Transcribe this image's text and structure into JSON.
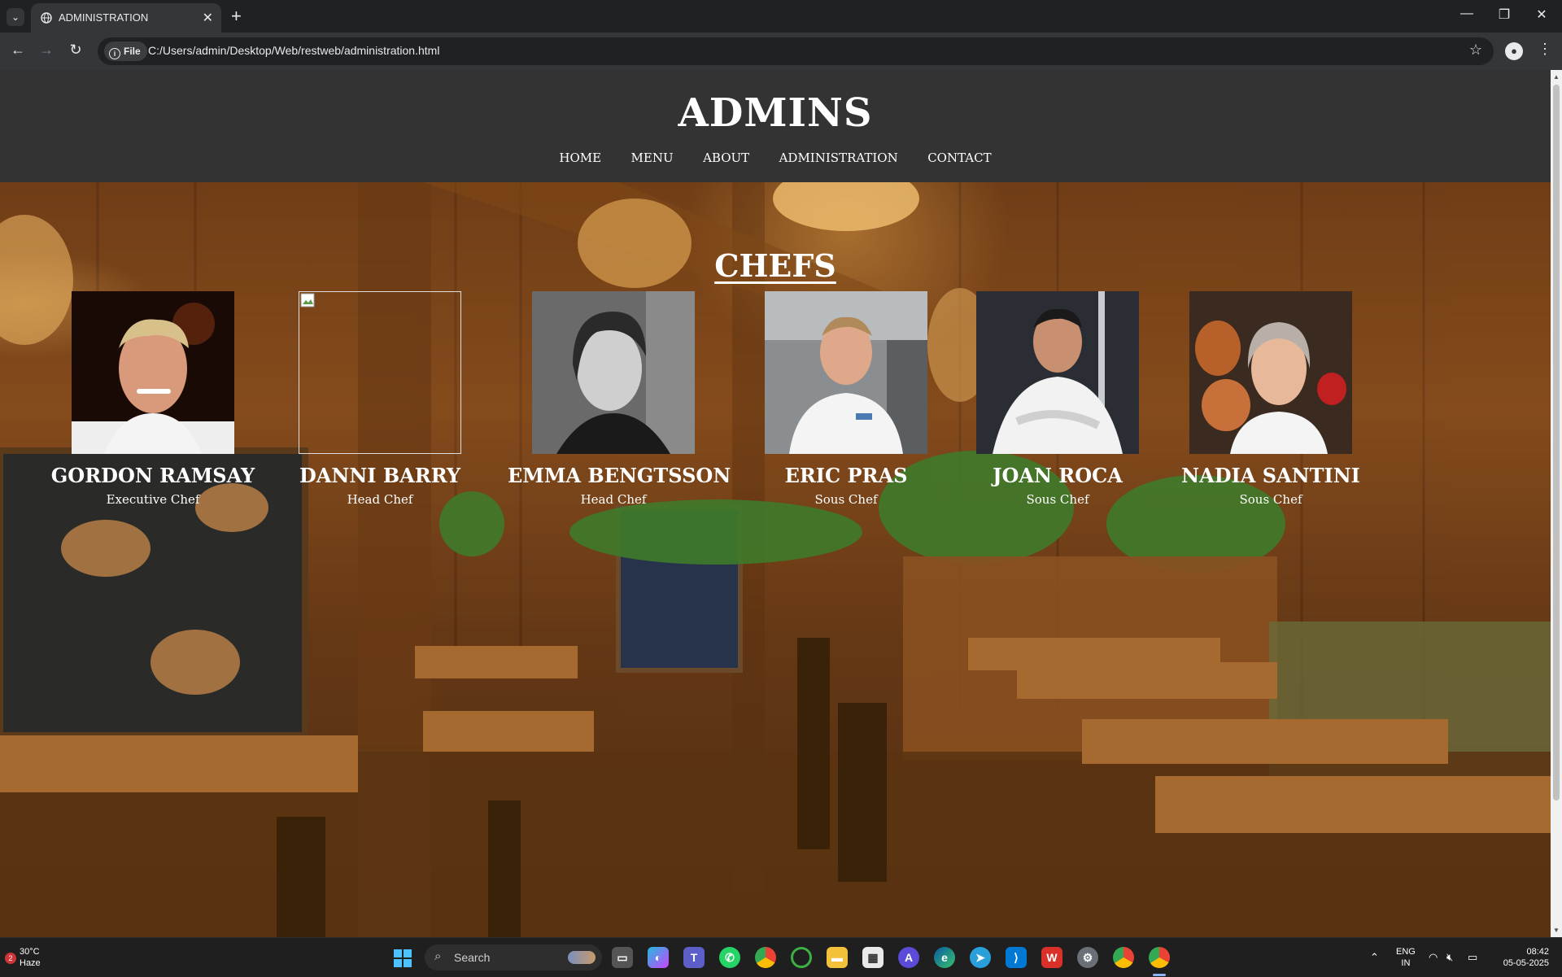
{
  "browser": {
    "tab_title": "ADMINISTRATION",
    "url_chip": "File",
    "url": "C:/Users/admin/Desktop/Web/restweb/administration.html"
  },
  "site": {
    "title": "ADMINS",
    "nav": [
      "HOME",
      "MENU",
      "ABOUT",
      "ADMINISTRATION",
      "CONTACT"
    ],
    "section_title": "CHEFS",
    "chefs": [
      {
        "name": "GORDON RAMSAY",
        "role": "Executive Chef"
      },
      {
        "name": "DANNI BARRY",
        "role": "Head Chef"
      },
      {
        "name": "EMMA BENGTSSON",
        "role": "Head Chef"
      },
      {
        "name": "ERIC PRAS",
        "role": "Sous Chef"
      },
      {
        "name": "JOAN ROCA",
        "role": "Sous Chef"
      },
      {
        "name": "NADIA SANTINI",
        "role": "Sous Chef"
      }
    ]
  },
  "taskbar": {
    "weather_badge": "2",
    "temperature": "30°C",
    "condition": "Haze",
    "search_label": "Search",
    "lang_line1": "ENG",
    "lang_line2": "IN",
    "time": "08:42",
    "date": "05-05-2025"
  },
  "icons": [
    "chevron-down-icon",
    "globe-icon",
    "close-icon",
    "plus-icon",
    "minimize-icon",
    "restore-icon",
    "back-icon",
    "forward-icon",
    "reload-icon",
    "info-icon",
    "star-icon",
    "profile-icon",
    "menu-icon",
    "windows-icon",
    "search-icon"
  ]
}
